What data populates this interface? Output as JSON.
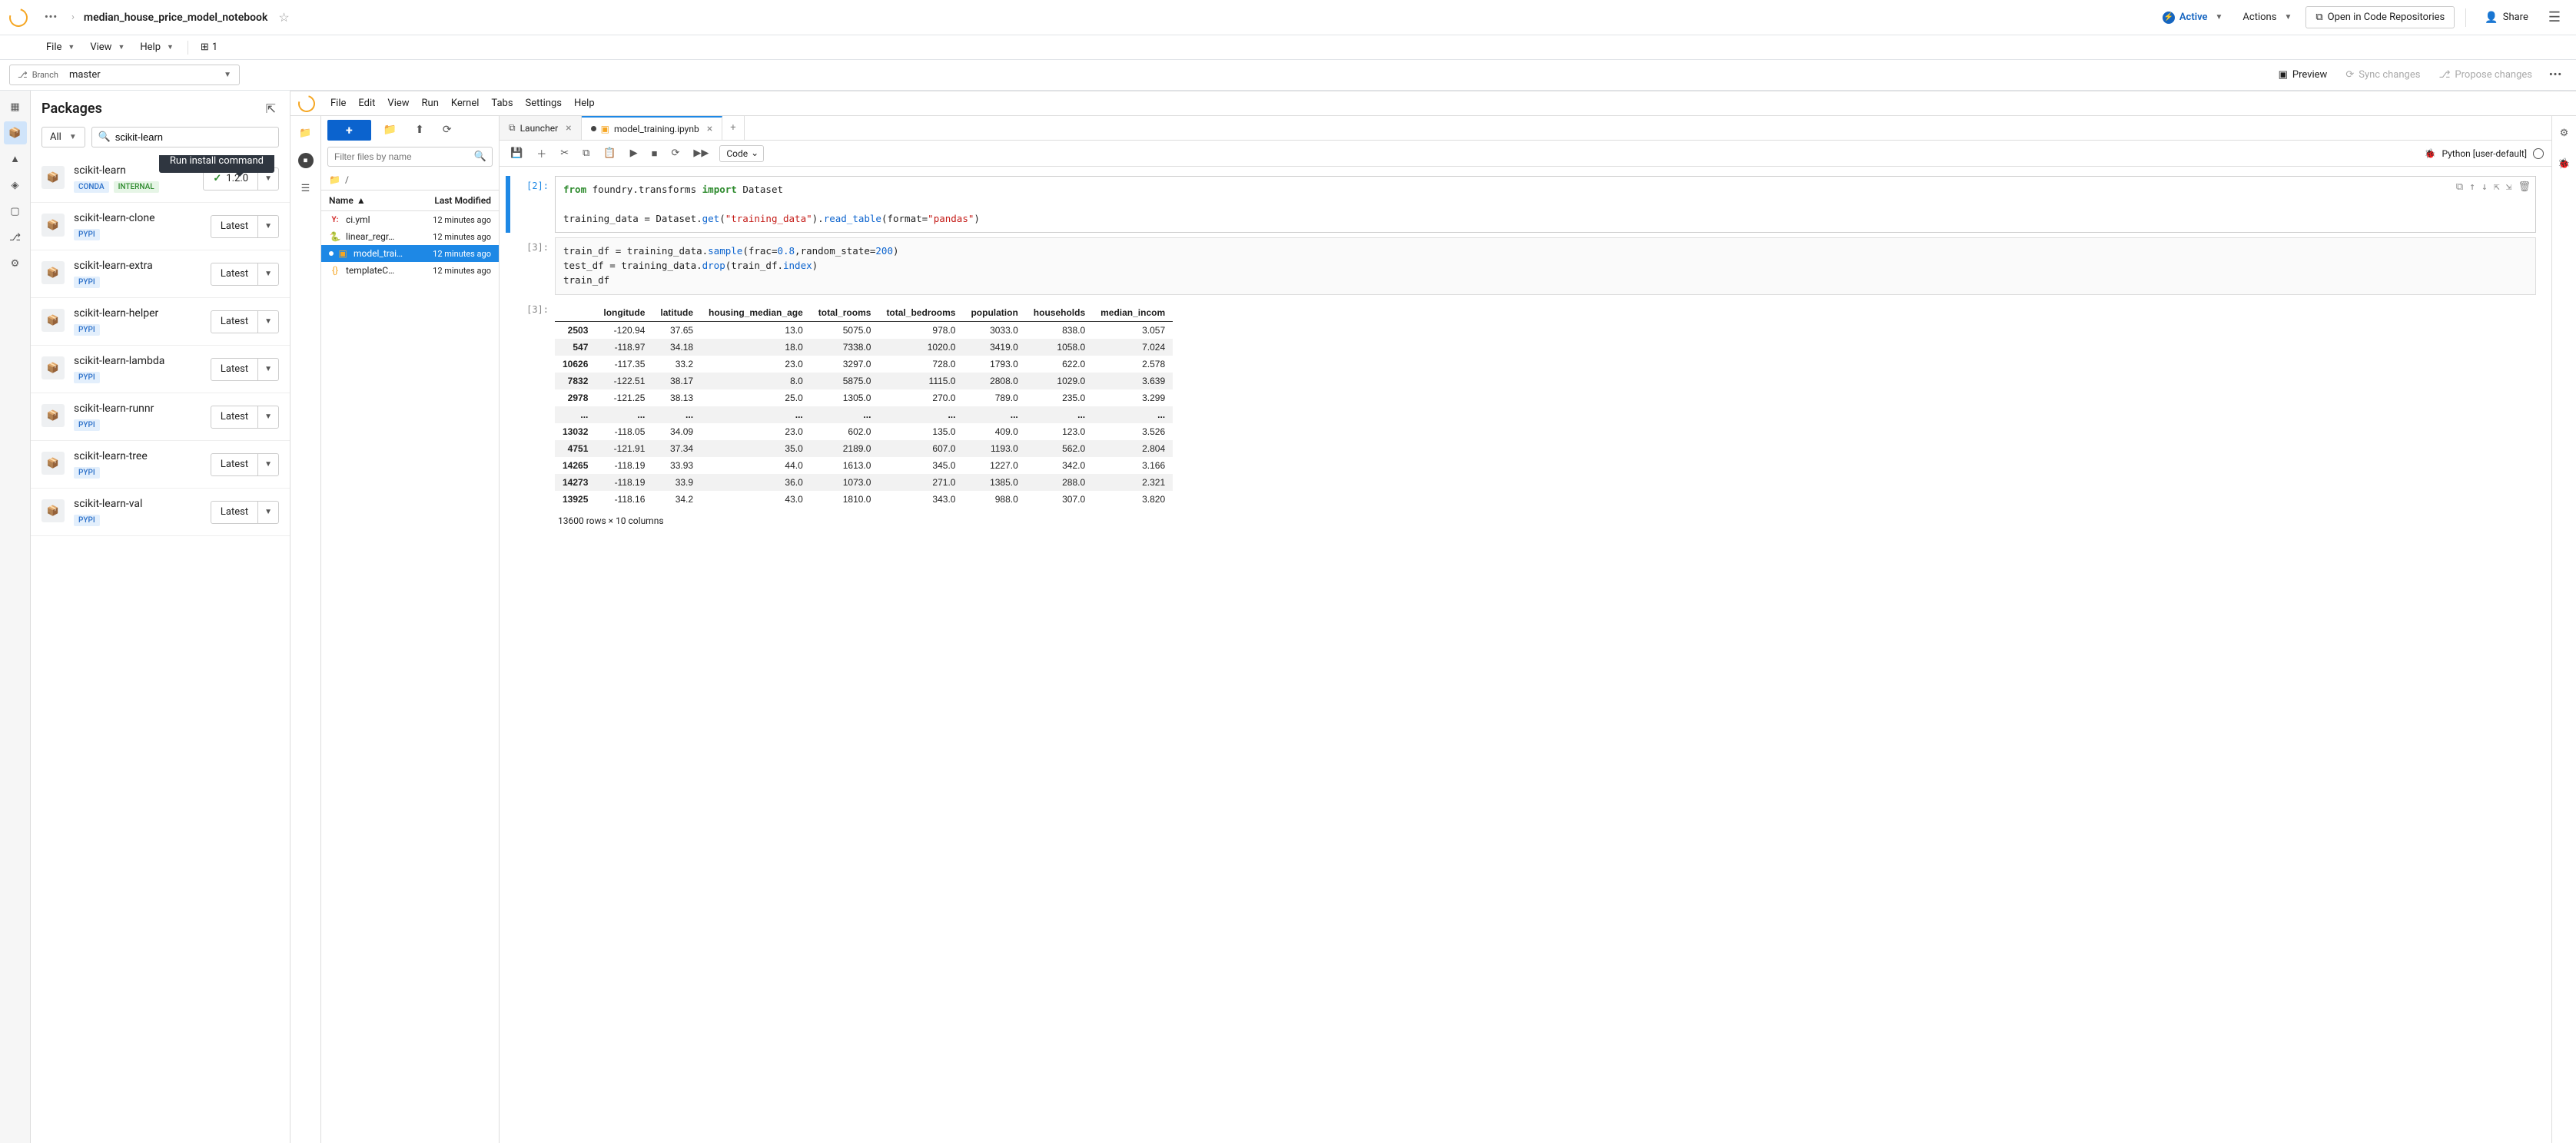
{
  "header": {
    "title": "median_house_price_model_notebook",
    "active_label": "Active",
    "actions_label": "Actions",
    "open_repo_label": "Open in Code Repositories",
    "share_label": "Share"
  },
  "menu": {
    "items": [
      "File",
      "View",
      "Help"
    ],
    "pipeline_count": "1"
  },
  "branch": {
    "label": "Branch",
    "name": "master",
    "preview": "Preview",
    "sync": "Sync changes",
    "propose": "Propose changes"
  },
  "packages": {
    "title": "Packages",
    "filter_label": "All",
    "search_value": "scikit-learn",
    "tooltip": "Run install command",
    "items": [
      {
        "name": "scikit-learn",
        "badges": [
          "CONDA",
          "INTERNAL"
        ],
        "version": "1.2.0",
        "installed": true
      },
      {
        "name": "scikit-learn-clone",
        "badges": [
          "PYPI"
        ],
        "version": "Latest",
        "installed": false
      },
      {
        "name": "scikit-learn-extra",
        "badges": [
          "PYPI"
        ],
        "version": "Latest",
        "installed": false
      },
      {
        "name": "scikit-learn-helper",
        "badges": [
          "PYPI"
        ],
        "version": "Latest",
        "installed": false
      },
      {
        "name": "scikit-learn-lambda",
        "badges": [
          "PYPI"
        ],
        "version": "Latest",
        "installed": false
      },
      {
        "name": "scikit-learn-runnr",
        "badges": [
          "PYPI"
        ],
        "version": "Latest",
        "installed": false
      },
      {
        "name": "scikit-learn-tree",
        "badges": [
          "PYPI"
        ],
        "version": "Latest",
        "installed": false
      },
      {
        "name": "scikit-learn-val",
        "badges": [
          "PYPI"
        ],
        "version": "Latest",
        "installed": false
      }
    ]
  },
  "jupyter": {
    "menu": [
      "File",
      "Edit",
      "View",
      "Run",
      "Kernel",
      "Tabs",
      "Settings",
      "Help"
    ],
    "file_filter_placeholder": "Filter files by name",
    "path": "/",
    "col_name": "Name",
    "col_modified": "Last Modified",
    "files": [
      {
        "icon": "yaml",
        "name": "ci.yml",
        "modified": "12 minutes ago",
        "selected": false,
        "dirty": false
      },
      {
        "icon": "py",
        "name": "linear_regr…",
        "modified": "12 minutes ago",
        "selected": false,
        "dirty": false
      },
      {
        "icon": "nb",
        "name": "model_trai…",
        "modified": "12 minutes ago",
        "selected": true,
        "dirty": true
      },
      {
        "icon": "json",
        "name": "templateC…",
        "modified": "12 minutes ago",
        "selected": false,
        "dirty": false
      }
    ],
    "tabs": [
      {
        "label": "Launcher",
        "icon": "launcher",
        "active": false,
        "dirty": false
      },
      {
        "label": "model_training.ipynb",
        "icon": "nb",
        "active": true,
        "dirty": true
      }
    ],
    "cell_type": "Code",
    "kernel": "Python [user-default]"
  },
  "cells": {
    "c2_prompt": "[2]:",
    "c2_line1_a": "from",
    "c2_line1_b": "foundry.transforms",
    "c2_line1_c": "import",
    "c2_line1_d": "Dataset",
    "c2_line2_a": "training_data = Dataset.",
    "c2_line2_b": "get",
    "c2_line2_c": "(",
    "c2_line2_d": "\"training_data\"",
    "c2_line2_e": ").",
    "c2_line2_f": "read_table",
    "c2_line2_g": "(format=",
    "c2_line2_h": "\"pandas\"",
    "c2_line2_i": ")",
    "c3_prompt": "[3]:",
    "c3_line1_a": "train_df = training_data.",
    "c3_line1_b": "sample",
    "c3_line1_c": "(frac=",
    "c3_line1_d": "0.8",
    "c3_line1_e": ",random_state=",
    "c3_line1_f": "200",
    "c3_line1_g": ")",
    "c3_line2_a": "test_df = training_data.",
    "c3_line2_b": "drop",
    "c3_line2_c": "(train_df.",
    "c3_line2_d": "index",
    "c3_line2_e": ")",
    "c3_line3": "train_df",
    "out3_prompt": "[3]:"
  },
  "output": {
    "columns": [
      "longitude",
      "latitude",
      "housing_median_age",
      "total_rooms",
      "total_bedrooms",
      "population",
      "households",
      "median_incom"
    ],
    "rows": [
      {
        "idx": "2503",
        "vals": [
          "-120.94",
          "37.65",
          "13.0",
          "5075.0",
          "978.0",
          "3033.0",
          "838.0",
          "3.057"
        ]
      },
      {
        "idx": "547",
        "vals": [
          "-118.97",
          "34.18",
          "18.0",
          "7338.0",
          "1020.0",
          "3419.0",
          "1058.0",
          "7.024"
        ]
      },
      {
        "idx": "10626",
        "vals": [
          "-117.35",
          "33.2",
          "23.0",
          "3297.0",
          "728.0",
          "1793.0",
          "622.0",
          "2.578"
        ]
      },
      {
        "idx": "7832",
        "vals": [
          "-122.51",
          "38.17",
          "8.0",
          "5875.0",
          "1115.0",
          "2808.0",
          "1029.0",
          "3.639"
        ]
      },
      {
        "idx": "2978",
        "vals": [
          "-121.25",
          "38.13",
          "25.0",
          "1305.0",
          "270.0",
          "789.0",
          "235.0",
          "3.299"
        ]
      },
      {
        "idx": "...",
        "vals": [
          "...",
          "...",
          "...",
          "...",
          "...",
          "...",
          "...",
          "..."
        ],
        "ellipsis": true
      },
      {
        "idx": "13032",
        "vals": [
          "-118.05",
          "34.09",
          "23.0",
          "602.0",
          "135.0",
          "409.0",
          "123.0",
          "3.526"
        ]
      },
      {
        "idx": "4751",
        "vals": [
          "-121.91",
          "37.34",
          "35.0",
          "2189.0",
          "607.0",
          "1193.0",
          "562.0",
          "2.804"
        ]
      },
      {
        "idx": "14265",
        "vals": [
          "-118.19",
          "33.93",
          "44.0",
          "1613.0",
          "345.0",
          "1227.0",
          "342.0",
          "3.166"
        ]
      },
      {
        "idx": "14273",
        "vals": [
          "-118.19",
          "33.9",
          "36.0",
          "1073.0",
          "271.0",
          "1385.0",
          "288.0",
          "2.321"
        ]
      },
      {
        "idx": "13925",
        "vals": [
          "-118.16",
          "34.2",
          "43.0",
          "1810.0",
          "343.0",
          "988.0",
          "307.0",
          "3.820"
        ]
      }
    ],
    "summary": "13600 rows × 10 columns"
  }
}
